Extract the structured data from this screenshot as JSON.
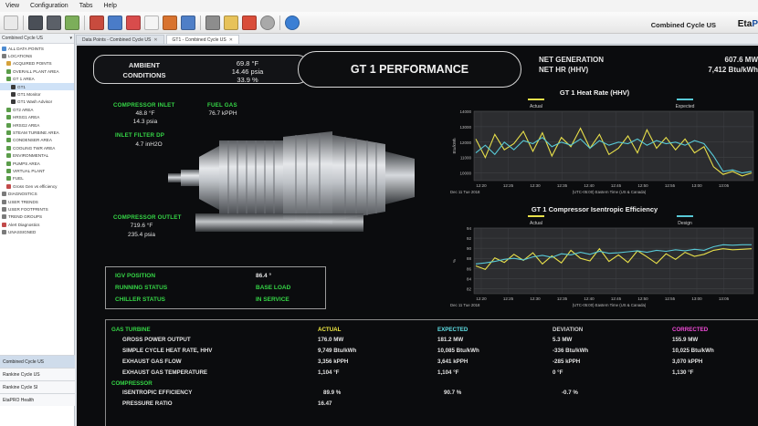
{
  "menu": [
    "View",
    "Configuration",
    "Tabs",
    "Help"
  ],
  "header": {
    "project_title": "Combined Cycle US",
    "logo_text_a": "Eta",
    "logo_text_b": "P"
  },
  "left_panel": {
    "title": "Combined Cycle US",
    "tree": [
      {
        "label": "ALL DATA POINTS",
        "color": "#4c8bd1",
        "sel": false
      },
      {
        "label": "LOCATIONS",
        "color": "#7b7b7b",
        "sel": false
      },
      {
        "label": "ACQUIRED POINTS",
        "color": "#d6a23a",
        "sel": false
      },
      {
        "label": "OVERALL PLANT AREA",
        "color": "#5b9d4a",
        "sel": false
      },
      {
        "label": "GT 1 AREA",
        "color": "#5b9d4a",
        "sel": false
      },
      {
        "label": "GT1",
        "color": "#3a3a3a",
        "sel": true
      },
      {
        "label": "GT1 Monitor",
        "color": "#3a3a3a",
        "sel": false
      },
      {
        "label": "GT1 Wash Advisor",
        "color": "#3a3a3a",
        "sel": false
      },
      {
        "label": "GT2 AREA",
        "color": "#5b9d4a",
        "sel": false
      },
      {
        "label": "HRSG1 AREA",
        "color": "#5b9d4a",
        "sel": false
      },
      {
        "label": "HRSG2 AREA",
        "color": "#5b9d4a",
        "sel": false
      },
      {
        "label": "STEAM TURBINE AREA",
        "color": "#5b9d4a",
        "sel": false
      },
      {
        "label": "CONDENSER AREA",
        "color": "#5b9d4a",
        "sel": false
      },
      {
        "label": "COOLING TWR AREA",
        "color": "#5b9d4a",
        "sel": false
      },
      {
        "label": "ENVIRONMENTAL",
        "color": "#5b9d4a",
        "sel": false
      },
      {
        "label": "PUMPS AREA",
        "color": "#5b9d4a",
        "sel": false
      },
      {
        "label": "VIRTUAL PLANT",
        "color": "#5b9d4a",
        "sel": false
      },
      {
        "label": "FUEL",
        "color": "#5b9d4a",
        "sel": false
      },
      {
        "label": "Gross Gen vs efficiency",
        "color": "#c24a4a",
        "sel": false
      },
      {
        "label": "DIAGNOSTICS",
        "color": "#7b7b7b",
        "sel": false
      },
      {
        "label": "USER TRENDS",
        "color": "#7b7b7b",
        "sel": false
      },
      {
        "label": "USER FOOTPRINTS",
        "color": "#7b7b7b",
        "sel": false
      },
      {
        "label": "TREND GROUPS",
        "color": "#7b7b7b",
        "sel": false
      },
      {
        "label": "Alert Diagnostics",
        "color": "#c24a4a",
        "sel": false
      },
      {
        "label": "UNASSIGNED",
        "color": "#7b7b7b",
        "sel": false
      }
    ],
    "bottom_tabs": [
      "Combined Cycle US",
      "Rankine Cycle US",
      "Rankine Cycle SI",
      "EtaPRO Health"
    ]
  },
  "tabs": [
    {
      "label": "Data Points - Combined Cycle US",
      "active": false
    },
    {
      "label": "GT1 - Combined Cycle US",
      "active": true
    }
  ],
  "ambient": {
    "label_line1": "AMBIENT",
    "label_line2": "CONDITIONS",
    "temp": "69.8 °F",
    "pressure": "14.46 psia",
    "humidity": "33.9 %"
  },
  "page_title": "GT 1 PERFORMANCE",
  "net": {
    "gen_label": "NET GENERATION",
    "gen_value": "607.6 MW",
    "hr_label": "NET HR (HHV)",
    "hr_value": "7,412 Btu/kWh"
  },
  "compressor_inlet": {
    "label": "COMPRESSOR INLET",
    "temp": "48.8 °F",
    "press": "14.3 psia"
  },
  "fuel_gas": {
    "label": "FUEL GAS",
    "value": "76.7 kPPH"
  },
  "inlet_filter": {
    "label": "INLET FILTER DP",
    "value": "4.7 inH2O"
  },
  "compressor_outlet": {
    "label": "COMPRESSOR OUTLET",
    "temp": "719.6 °F",
    "press": "235.4 psia"
  },
  "status": {
    "igv_label": "IGV POSITION",
    "igv_value": "86.4 °",
    "running_label": "RUNNING STATUS",
    "running_value": "BASE LOAD",
    "chiller_label": "CHILLER STATUS",
    "chiller_value": "IN SERVICE"
  },
  "colors": {
    "green": "#35d646",
    "yellow": "#f3ec43",
    "cyan": "#5fe0e6",
    "magenta": "#f24bd9"
  },
  "chart_data": [
    {
      "type": "line",
      "title": "GT 1 Heat Rate (HHV)",
      "ylabel": "Btu/kWh",
      "xlabel": "(UTC-05:00) Eastern Time (US & Canada)",
      "date_label": "Dec 11 Tue 2018",
      "x": [
        "12:20",
        "12:25",
        "12:30",
        "12:35",
        "12:40",
        "12:45",
        "12:50",
        "12:55",
        "13:00",
        "13:05"
      ],
      "ylim": [
        9500,
        14000
      ],
      "yticks": [
        10000,
        11000,
        12000,
        13000,
        14000
      ],
      "legend_position": "top",
      "series": [
        {
          "name": "Actual",
          "color": "#e8e04a",
          "values": [
            12200,
            11000,
            12500,
            11500,
            11900,
            12700,
            11400,
            12600,
            11100,
            12300,
            11700,
            12900,
            11600,
            12500,
            11200,
            11600,
            12400,
            11300,
            12800,
            11600,
            12300,
            11500,
            12200,
            11300,
            11700,
            10400,
            9900,
            10100,
            9800,
            10000
          ]
        },
        {
          "name": "Expected",
          "color": "#58c9d6",
          "values": [
            11300,
            11800,
            11200,
            12000,
            11500,
            12100,
            11900,
            12300,
            11700,
            12000,
            11800,
            12200,
            11600,
            12100,
            11800,
            12000,
            11900,
            12200,
            11800,
            12100,
            11900,
            12000,
            11800,
            12100,
            11900,
            11100,
            10100,
            10200,
            10000,
            10100
          ]
        }
      ]
    },
    {
      "type": "line",
      "title": "GT 1 Compressor Isentropic Efficiency",
      "ylabel": "%",
      "xlabel": "(UTC-05:00) Eastern Time (US & Canada)",
      "date_label": "Dec 11 Tue 2018",
      "x": [
        "12:20",
        "12:25",
        "12:30",
        "12:35",
        "12:40",
        "12:45",
        "12:50",
        "12:55",
        "13:00",
        "13:05"
      ],
      "ylim": [
        81,
        94
      ],
      "yticks": [
        82,
        84,
        86,
        88,
        90,
        92,
        94
      ],
      "legend_position": "top",
      "series": [
        {
          "name": "Actual",
          "color": "#e8e04a",
          "values": [
            86.5,
            85.8,
            88.1,
            87.2,
            88.8,
            87.6,
            89.1,
            86.9,
            88.5,
            87.1,
            89.6,
            88.0,
            87.5,
            89.9,
            87.4,
            88.7,
            87.2,
            89.5,
            88.3,
            87.0,
            88.9,
            87.8,
            89.2,
            88.4,
            88.8,
            89.6,
            89.9,
            89.7,
            89.8,
            89.9
          ]
        },
        {
          "name": "Design",
          "color": "#58c9d6",
          "values": [
            86.9,
            87.1,
            87.4,
            87.8,
            88.0,
            87.7,
            88.3,
            88.6,
            88.2,
            88.9,
            88.7,
            89.2,
            88.8,
            89.4,
            89.0,
            89.1,
            89.3,
            89.5,
            89.2,
            89.6,
            89.4,
            89.7,
            89.5,
            89.8,
            89.6,
            90.3,
            90.7,
            90.6,
            90.7,
            90.7
          ]
        }
      ]
    }
  ],
  "perf_table": {
    "headers": {
      "section": "GAS TURBINE",
      "actual": "ACTUAL",
      "expected": "EXPECTED",
      "deviation": "DEVIATION",
      "corrected": "CORRECTED"
    },
    "rows": [
      {
        "label": "GROSS POWER OUTPUT",
        "actual": "176.0 MW",
        "expected": "181.2 MW",
        "deviation": "5.3 MW",
        "corrected": "155.9 MW"
      },
      {
        "label": "SIMPLE CYCLE HEAT RATE, HHV",
        "actual": "9,749 Btu/kWh",
        "expected": "10,085 Btu/kWh",
        "deviation": "-336 Btu/kWh",
        "corrected": "10,025 Btu/kWh"
      },
      {
        "label": "EXHAUST GAS FLOW",
        "actual": "3,356 kPPH",
        "expected": "3,641 kPPH",
        "deviation": "-285 kPPH",
        "corrected": "3,070 kPPH"
      },
      {
        "label": "EXHAUST GAS TEMPERATURE",
        "actual": "1,104 °F",
        "expected": "1,104 °F",
        "deviation": "0 °F",
        "corrected": "1,130 °F"
      }
    ],
    "section2": "COMPRESSOR",
    "rows2": [
      {
        "label": "ISENTROPIC EFFICIENCY",
        "actual": "89.9 %",
        "expected": "90.7 %",
        "deviation": "-0.7 %"
      },
      {
        "label": "PRESSURE RATIO",
        "actual": "16.47"
      }
    ]
  }
}
